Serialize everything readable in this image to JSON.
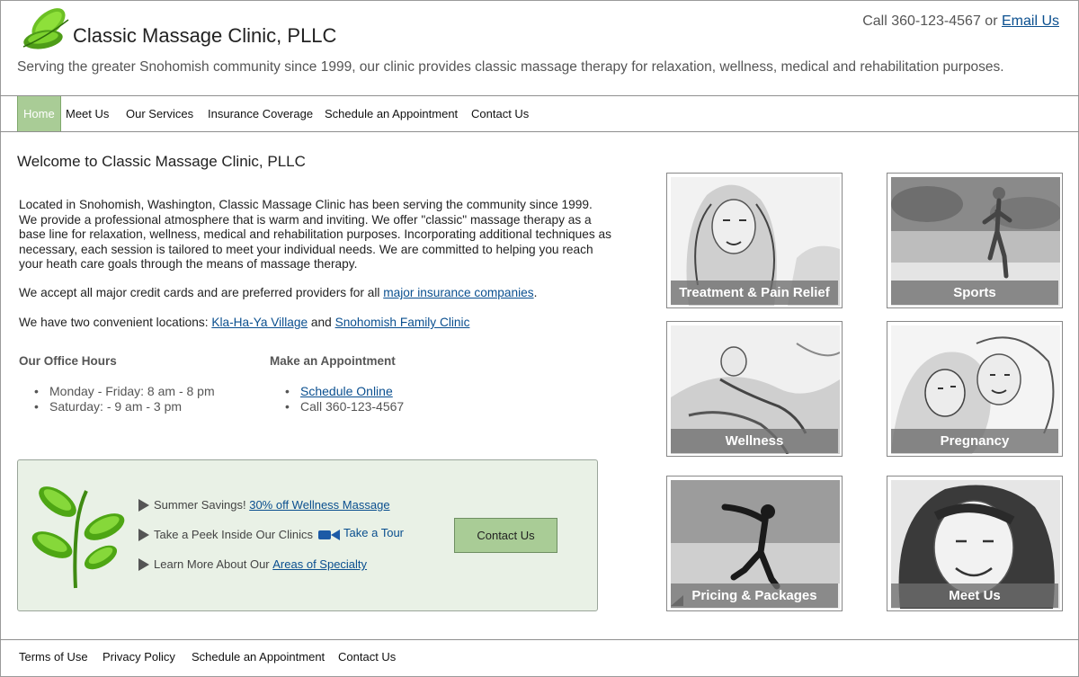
{
  "header": {
    "title": "Classic Massage Clinic, PLLC",
    "call_prefix": "Call 360-123-4567 or",
    "email_link": "Email Us",
    "tagline": "Serving the greater Snohomish community since 1999, our clinic provides classic massage therapy for relaxation, wellness, medical and rehabilitation purposes."
  },
  "nav": {
    "items": [
      "Home",
      "Meet Us",
      "Our Services",
      "Insurance Coverage",
      "Schedule an Appointment",
      "Contact Us"
    ],
    "active": "Home"
  },
  "main": {
    "welcome": "Welcome to Classic Massage Clinic, PLLC",
    "intro": "Located in Snohomish, Washington, Classic Massage Clinic has been serving the community since 1999. We provide a professional atmosphere that is warm and inviting. We offer \"classic\" massage therapy as a base line for relaxation, wellness, medical and rehabilitation purposes. Incorporating additional techniques as necessary, each session is tailored to meet your individual needs. We are committed to helping you reach your heath care goals through the means of massage therapy.",
    "credit_text": "We accept all major credit cards and are preferred providers for all",
    "credit_link": "major insurance companies",
    "credit_end": ".",
    "locations_text": "We have two convenient locations:",
    "location_1": "Kla-Ha-Ya Village",
    "locations_and": "and",
    "location_2": "Snohomish Family Clinic",
    "hours_title": "Our Office Hours",
    "hours": [
      "Monday - Friday: 8 am - 8 pm",
      "Saturday: - 9 am - 3 pm"
    ],
    "appt_title": "Make an Appointment",
    "appt_link": "Schedule Online",
    "appt_phone": "Call 360-123-4567",
    "bullet": "•"
  },
  "promo": {
    "line1_text": "Summer Savings!",
    "line1_link": "30% off Wellness Massage",
    "line2_text": "Take a Peek Inside Our Clinics",
    "line2_link": "Take a Tour",
    "line3_text": "Learn More About Our",
    "line3_link": "Areas of Specialty",
    "button": "Contact Us"
  },
  "tiles": [
    {
      "label": "Treatment & Pain Relief",
      "image": "woman-portrait-sketch"
    },
    {
      "label": "Sports",
      "image": "runner-sketch"
    },
    {
      "label": "Wellness",
      "image": "couple-relaxing-sketch"
    },
    {
      "label": "Pregnancy",
      "image": "mother-child-sketch"
    },
    {
      "label": "Pricing & Packages",
      "image": "athlete-silhouette"
    },
    {
      "label": "Meet Us",
      "image": "smiling-girl-sketch"
    }
  ],
  "footer": {
    "items": [
      "Terms of Use",
      "Privacy Policy",
      "Schedule an Appointment",
      "Contact Us"
    ]
  },
  "colors": {
    "accent_green": "#a9cc96",
    "promo_bg": "#e9f1e6",
    "link_blue": "#0a4f8f"
  }
}
